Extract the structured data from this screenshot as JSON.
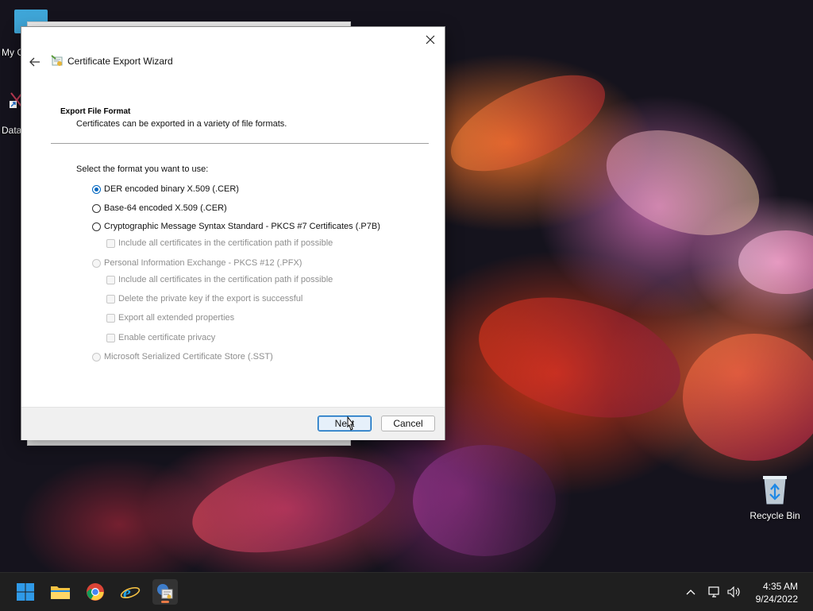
{
  "desktop": {
    "icons": {
      "my_computer_label": "My C",
      "data_label": "Data",
      "recycle_bin_label": "Recycle Bin"
    }
  },
  "dialog": {
    "title": "Certificate Export Wizard",
    "section_heading": "Export File Format",
    "section_description": "Certificates can be exported in a variety of file formats.",
    "prompt": "Select the format you want to use:",
    "options": [
      {
        "label": "DER encoded binary X.509 (.CER)",
        "type": "radio",
        "checked": true,
        "enabled": true
      },
      {
        "label": "Base-64 encoded X.509 (.CER)",
        "type": "radio",
        "checked": false,
        "enabled": true
      },
      {
        "label": "Cryptographic Message Syntax Standard - PKCS #7 Certificates (.P7B)",
        "type": "radio",
        "checked": false,
        "enabled": true
      },
      {
        "label": "Include all certificates in the certification path if possible",
        "type": "checkbox",
        "checked": false,
        "enabled": false
      },
      {
        "label": "Personal Information Exchange - PKCS #12 (.PFX)",
        "type": "radio",
        "checked": false,
        "enabled": false
      },
      {
        "label": "Include all certificates in the certification path if possible",
        "type": "checkbox",
        "checked": false,
        "enabled": false
      },
      {
        "label": "Delete the private key if the export is successful",
        "type": "checkbox",
        "checked": false,
        "enabled": false
      },
      {
        "label": "Export all extended properties",
        "type": "checkbox",
        "checked": false,
        "enabled": false
      },
      {
        "label": "Enable certificate privacy",
        "type": "checkbox",
        "checked": false,
        "enabled": false
      },
      {
        "label": "Microsoft Serialized Certificate Store (.SST)",
        "type": "radio",
        "checked": false,
        "enabled": false
      }
    ],
    "buttons": {
      "next_label": "Next",
      "cancel_label": "Cancel"
    }
  },
  "taskbar": {
    "apps": [
      "start-icon",
      "file-explorer-icon",
      "chrome-icon",
      "internet-explorer-icon",
      "certificate-manager-icon"
    ],
    "clock": {
      "time": "4:35 AM",
      "date": "9/24/2022"
    }
  },
  "colors": {
    "accent": "#0067c0",
    "taskbar": "#1f1f1f",
    "active_indicator": "#e97a46"
  }
}
